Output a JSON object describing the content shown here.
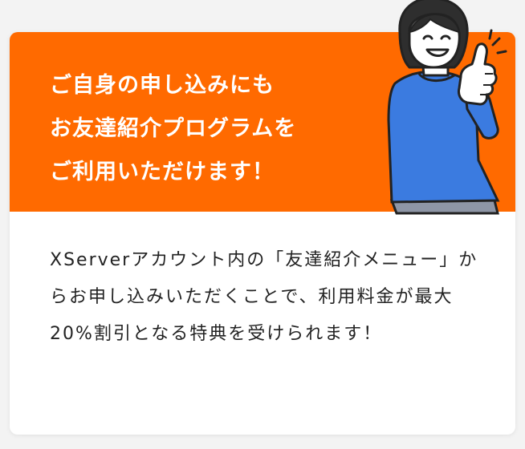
{
  "banner": {
    "background": "#ff6a00",
    "headline_lines": [
      "ご自身の申し込みにも",
      "お友達紹介プログラムを",
      "ご利用いただけます！"
    ]
  },
  "body": {
    "text": "XServerアカウント内の「友達紹介メニュー」からお申し込みいただくことで、利用料金が最大20%割引となる特典を受けられます！"
  },
  "illustration": {
    "icon": "person-thumbs-up-icon",
    "shirt_color": "#3b7be0"
  }
}
